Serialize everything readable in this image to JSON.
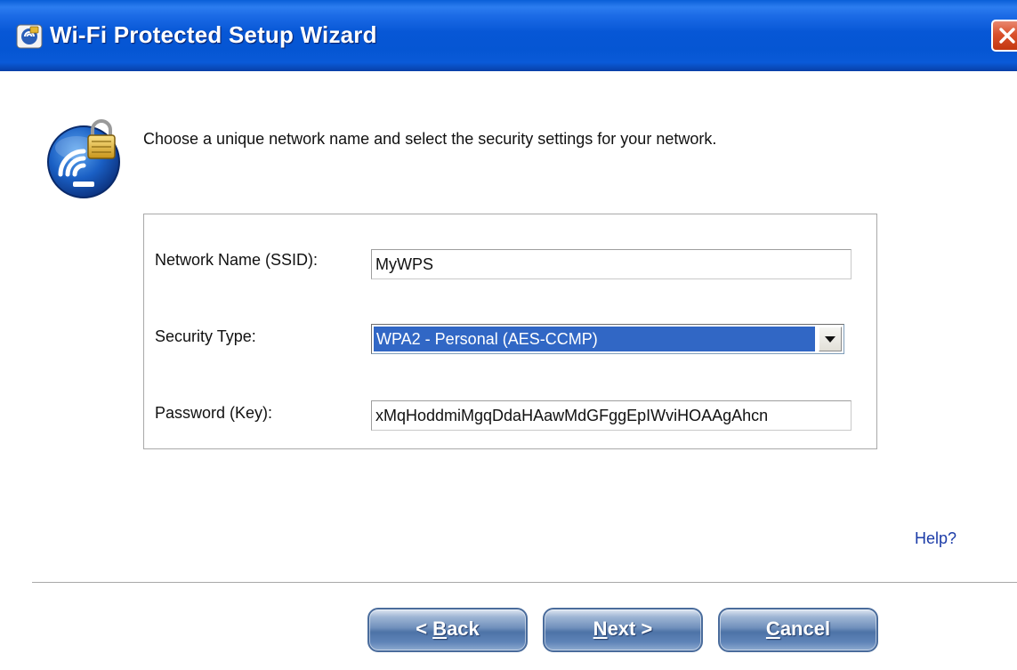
{
  "window": {
    "title": "Wi-Fi Protected Setup Wizard"
  },
  "instruction": "Choose a unique network name and select the security settings for your network.",
  "form": {
    "ssid_label": "Network Name (SSID):",
    "ssid_value": "MyWPS",
    "security_label": "Security Type:",
    "security_value": "WPA2 - Personal (AES-CCMP)",
    "password_label": "Password (Key):",
    "password_value": "xMqHoddmiMgqDdaHAawMdGFggEpIWviHOAAgAhcn"
  },
  "help_link": "Help?",
  "buttons": {
    "back_prefix": "< ",
    "back_access": "B",
    "back_rest": "ack",
    "next_access": "N",
    "next_rest": "ext >",
    "cancel_access": "C",
    "cancel_rest": "ancel"
  },
  "colors": {
    "titlebar": "#0556d3",
    "selection": "#3167c5",
    "link": "#1c3ca8",
    "close_button": "#d9512c"
  },
  "icons": {
    "app": "wizard-app-icon",
    "wizard": "wifi-lock-icon",
    "close": "close-icon",
    "dropdown": "chevron-down-icon"
  }
}
